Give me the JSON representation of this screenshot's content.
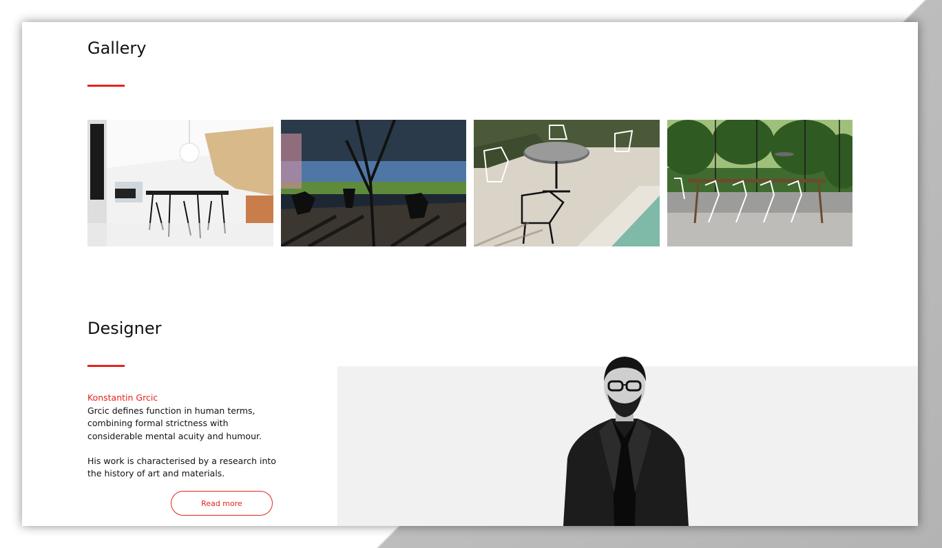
{
  "gallery": {
    "title": "Gallery",
    "images": [
      {
        "name": "interior-dining-room-photo"
      },
      {
        "name": "terrace-tree-photo"
      },
      {
        "name": "poolside-chairs-photo"
      },
      {
        "name": "forest-glass-house-photo"
      }
    ]
  },
  "designer": {
    "title": "Designer",
    "name": "Konstantin Grcic",
    "bio_paragraph_1": "Grcic defines function in human terms, combining formal strictness with considerable mental acuity and humour.",
    "bio_paragraph_2": "His work is characterised by a research into the history of art and materials.",
    "read_more_label": "Read more"
  },
  "colors": {
    "accent": "#e3241b",
    "panel": "#f1f1f1"
  }
}
